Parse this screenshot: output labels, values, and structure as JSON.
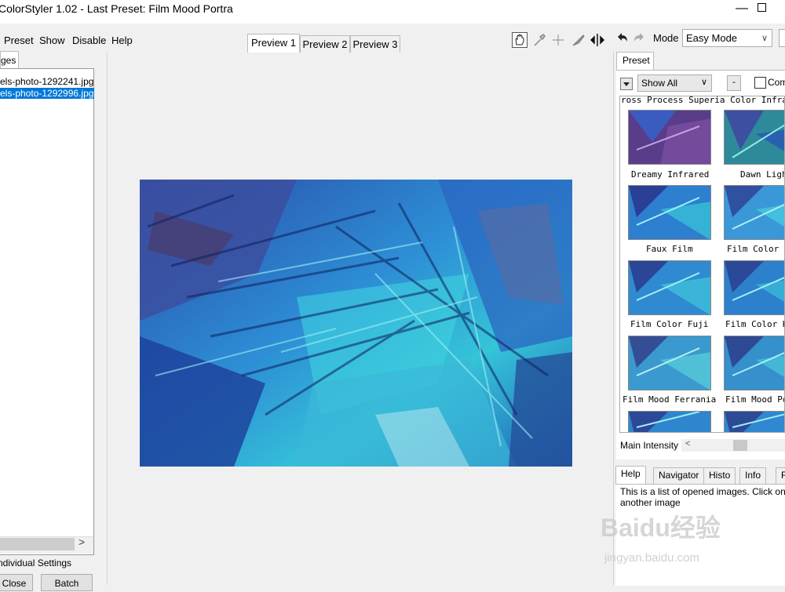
{
  "window": {
    "title": "ColorStyler 1.02 - Last Preset: Film Mood Portra"
  },
  "menu": [
    "Preset",
    "Show",
    "Disable",
    "Help"
  ],
  "left": {
    "tab_label": "ges",
    "files": [
      "els-photo-1292241.jpg",
      "els-photo-1292996.jpg"
    ],
    "individual_settings": "ndividual Settings",
    "close_button": "Close",
    "batch_button": "Batch"
  },
  "preview_tabs": [
    "Preview 1",
    "Preview 2",
    "Preview 3"
  ],
  "toolbar": {
    "tools": [
      "hand-icon",
      "eyedropper-icon",
      "crosshair-icon",
      "brush-icon",
      "split-icon"
    ],
    "undo_icon": "undo-icon",
    "redo_icon": "redo-icon"
  },
  "mode": {
    "label": "Mode",
    "value": "Easy Mode"
  },
  "preset_panel": {
    "tab_label": "Preset",
    "filter_value": "Show All",
    "dot_button": "-",
    "compare_label": "Com",
    "header_row": "ross Process Superia Color Infra",
    "presets": [
      "Dreamy Infrared",
      "Dawn Ligh",
      "Faux Film",
      "Film Color",
      "Film Color Fuji",
      "Film Color K",
      "Film Mood Ferrania",
      "Film Mood Po",
      "",
      ""
    ],
    "intensity_label": "Main Intensity"
  },
  "bottom_tabs": [
    "Help",
    "Navigator",
    "Histo",
    "Info",
    "F"
  ],
  "help": {
    "line1": "This is a list of opened images. Click on i",
    "line2": "another image"
  },
  "watermark": {
    "logo": "Baidu经验",
    "url": "jingyan.baidu.com"
  },
  "colors": {
    "selection": "#0078d7",
    "background": "#f0f0f0"
  }
}
